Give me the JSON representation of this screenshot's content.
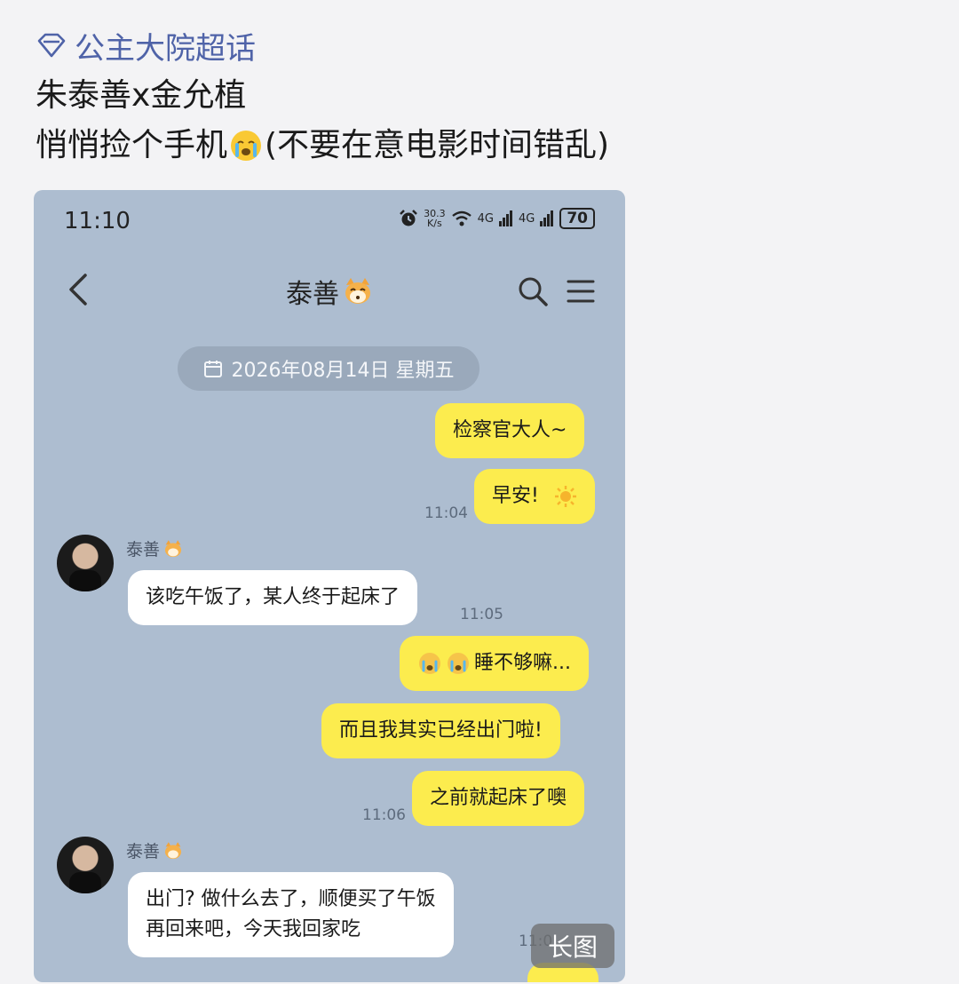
{
  "post": {
    "topic": "公主大院超话",
    "line1": "朱泰善x金允植",
    "line2_a": "悄悄捡个手机",
    "line2_b": "(不要在意电影时间错乱)",
    "long_image_badge": "长图"
  },
  "phone": {
    "status_time": "11:10",
    "net_speed_top": "30.3",
    "net_speed_unit": "K/s",
    "signal1": "4G",
    "signal2": "4G",
    "battery": "70",
    "chat_title": "泰善",
    "date_pill": "2026年08月14日 星期五"
  },
  "messages": [
    {
      "text": "检察官大人~"
    },
    {
      "text": "早安!",
      "time": "11:04"
    },
    {
      "sender": "泰善",
      "text": "该吃午饭了，某人终于起床了",
      "time": "11:05"
    },
    {
      "text": "睡不够嘛..."
    },
    {
      "text": "而且我其实已经出门啦!"
    },
    {
      "text": "之前就起床了噢",
      "time": "11:06"
    },
    {
      "sender": "泰善",
      "text_line1": "出门? 做什么去了，顺便买了午饭",
      "text_line2": "再回来吧，今天我回家吃",
      "time": "11:0"
    }
  ],
  "icons": [
    "diamond-icon",
    "cry-emoji-icon",
    "alarm-icon",
    "wifi-icon",
    "back-icon",
    "cat-emoji-icon",
    "search-icon",
    "menu-icon",
    "calendar-icon",
    "sun-emoji-icon",
    "avatar"
  ],
  "colors": {
    "chat_bg": "#adbdd0",
    "my_bubble": "#fcec4e",
    "topic": "#4f63a8"
  }
}
